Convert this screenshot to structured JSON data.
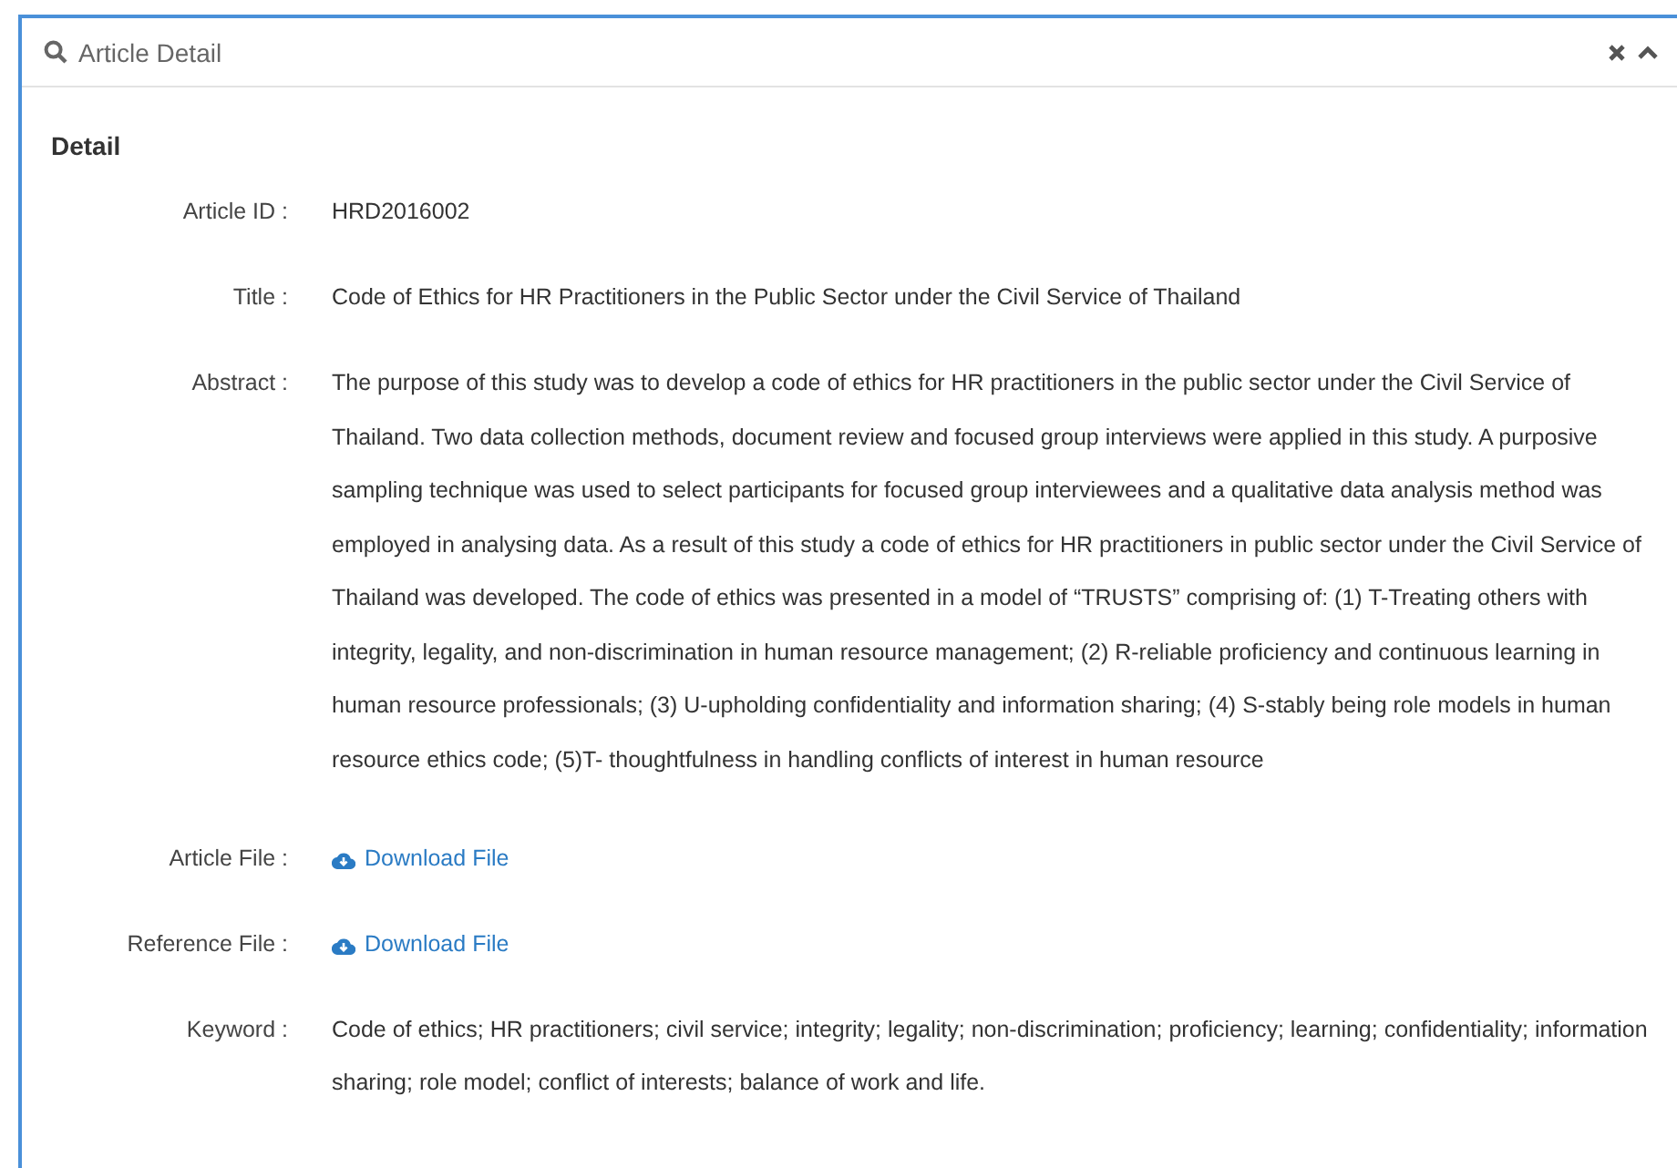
{
  "panel": {
    "title": "Article Detail"
  },
  "section_title": "Detail",
  "fields": [
    {
      "kind": "text",
      "label": "Article ID :",
      "value": "HRD2016002"
    },
    {
      "kind": "text",
      "label": "Title :",
      "value": "Code of Ethics for HR Practitioners in the Public Sector under the Civil Service of Thailand"
    },
    {
      "kind": "scroll",
      "label": "Abstract :",
      "value": "The purpose of this study was to develop a code of ethics for HR practitioners in the public sector under the Civil Service of Thailand. Two data collection methods, document review and focused group interviews were applied in this study. A purposive sampling technique was used to select participants for focused group interviewees and a qualitative data analysis method was employed in analysing data. As a result of this study a code of ethics for HR practitioners in public sector under the Civil Service of Thailand was developed. The code of ethics was presented in a model of “TRUSTS” comprising of: (1) T-Treating others with integrity, legality, and non-discrimination in human resource management; (2) R-reliable proficiency and continuous learning in human resource professionals; (3) U-upholding confidentiality and information sharing; (4) S-stably being role models in human resource ethics code; (5)T- thoughtfulness in handling conflicts of interest in human resource"
    },
    {
      "kind": "download",
      "label": "Article File :",
      "value": "Download File"
    },
    {
      "kind": "download",
      "label": "Reference File :",
      "value": "Download File"
    },
    {
      "kind": "text",
      "label": "Keyword :",
      "value": "Code of ethics; HR practitioners; civil service; integrity; legality; non-discrimination; proficiency; learning; confidentiality; information sharing; role model; conflict of interests; balance of work and life."
    }
  ]
}
